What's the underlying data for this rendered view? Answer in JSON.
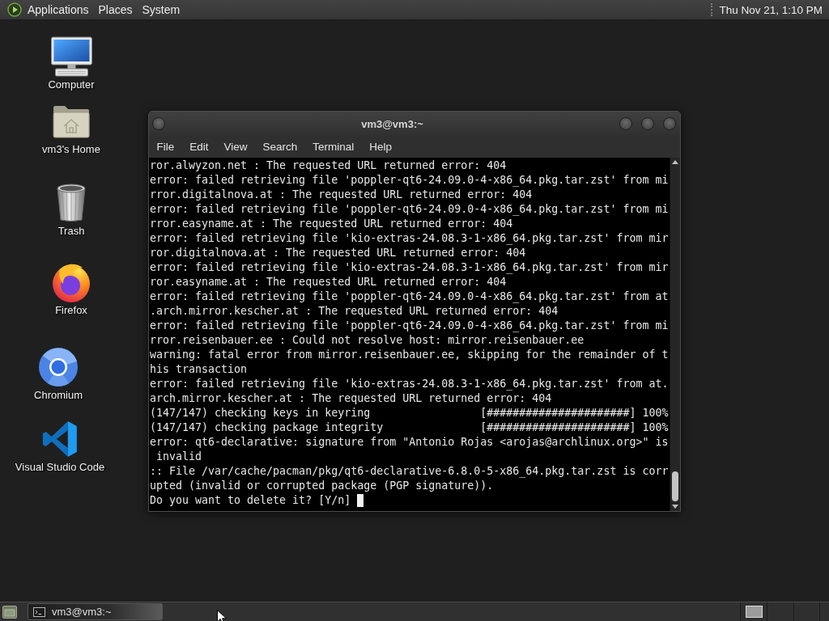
{
  "top_panel": {
    "menus": [
      "Applications",
      "Places",
      "System"
    ],
    "clock": "Thu Nov 21, 1:10 PM"
  },
  "desktop_icons": [
    {
      "kind": "computer",
      "label": "Computer"
    },
    {
      "kind": "home",
      "label": "vm3's Home"
    },
    {
      "kind": "trash",
      "label": "Trash"
    },
    {
      "kind": "firefox",
      "label": "Firefox"
    },
    {
      "kind": "chromium",
      "label": "Chromium"
    },
    {
      "kind": "vscode",
      "label": "Visual Studio Code"
    }
  ],
  "window": {
    "title": "vm3@vm3:~",
    "menu": [
      "File",
      "Edit",
      "View",
      "Search",
      "Terminal",
      "Help"
    ],
    "lines": [
      "ror.alwyzon.net : The requested URL returned error: 404",
      "error: failed retrieving file 'poppler-qt6-24.09.0-4-x86_64.pkg.tar.zst' from mi",
      "rror.digitalnova.at : The requested URL returned error: 404",
      "error: failed retrieving file 'poppler-qt6-24.09.0-4-x86_64.pkg.tar.zst' from mi",
      "rror.easyname.at : The requested URL returned error: 404",
      "error: failed retrieving file 'kio-extras-24.08.3-1-x86_64.pkg.tar.zst' from mir",
      "ror.digitalnova.at : The requested URL returned error: 404",
      "error: failed retrieving file 'kio-extras-24.08.3-1-x86_64.pkg.tar.zst' from mir",
      "ror.easyname.at : The requested URL returned error: 404",
      "error: failed retrieving file 'poppler-qt6-24.09.0-4-x86_64.pkg.tar.zst' from at",
      ".arch.mirror.kescher.at : The requested URL returned error: 404",
      "error: failed retrieving file 'poppler-qt6-24.09.0-4-x86_64.pkg.tar.zst' from mi",
      "rror.reisenbauer.ee : Could not resolve host: mirror.reisenbauer.ee",
      "warning: fatal error from mirror.reisenbauer.ee, skipping for the remainder of t",
      "his transaction",
      "error: failed retrieving file 'kio-extras-24.08.3-1-x86_64.pkg.tar.zst' from at.",
      "arch.mirror.kescher.at : The requested URL returned error: 404",
      "(147/147) checking keys in keyring                 [######################] 100%",
      "(147/147) checking package integrity               [######################] 100%",
      "error: qt6-declarative: signature from \"Antonio Rojas <arojas@archlinux.org>\" is",
      " invalid",
      ":: File /var/cache/pacman/pkg/qt6-declarative-6.8.0-5-x86_64.pkg.tar.zst is corr",
      "upted (invalid or corrupted package (PGP signature)).",
      "Do you want to delete it? [Y/n]"
    ]
  },
  "taskbar": {
    "tasks": [
      {
        "label": "vm3@vm3:~"
      }
    ]
  }
}
